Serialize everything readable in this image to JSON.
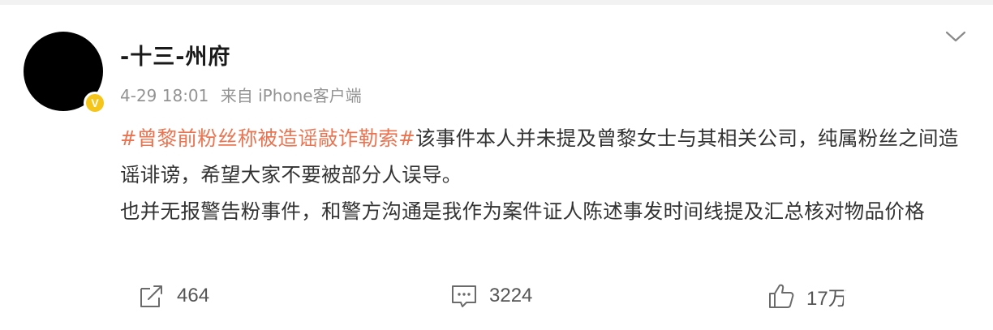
{
  "user": {
    "name": "-十三-州府",
    "verified_badge": "V"
  },
  "post": {
    "time": "4-29 18:01",
    "source": "来自 iPhone客户端",
    "topic": "#曾黎前粉丝称被造谣敲诈勒索#",
    "body_line1": "该事件本人并未提及曾黎女士与其相关公司，纯属粉丝之间造谣诽谤，希望大家不要被部分人误导。",
    "body_line2": "也并无报警告粉事件，和警方沟通是我作为案件证人陈述事发时间线提及汇总核对物品价格"
  },
  "actions": {
    "repost_count": "464",
    "comment_count": "3224",
    "like_count": "17万"
  },
  "icons": {
    "more": "chevron-down-icon",
    "repost": "share-icon",
    "comment": "comment-icon",
    "like": "thumbs-up-icon"
  },
  "colors": {
    "topic": "#eb7350",
    "badge": "#f6c51a"
  }
}
